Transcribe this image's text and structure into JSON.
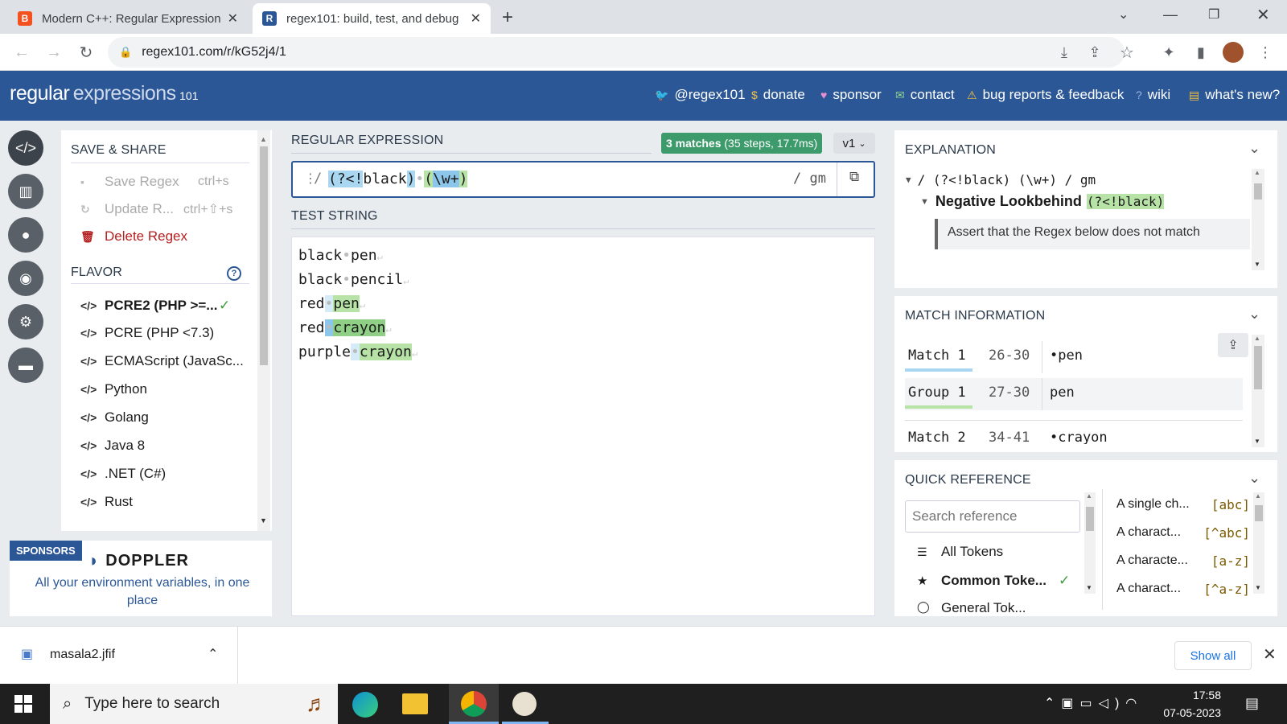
{
  "browser": {
    "tabs": [
      {
        "title": "Modern C++: Regular Expression",
        "favicon": "B",
        "favicon_color": "#f4511e"
      },
      {
        "title": "regex101: build, test, and debug",
        "favicon": "R",
        "favicon_color": "#2b5797"
      }
    ],
    "url": "regex101.com/r/kG52j4/1"
  },
  "site": {
    "logo_main": "regular",
    "logo_sub": "expressions",
    "logo_num": "101",
    "links": [
      "@regex101",
      "donate",
      "sponsor",
      "contact",
      "bug reports & feedback",
      "wiki",
      "what's new?"
    ]
  },
  "sidebar": {
    "save_title": "SAVE & SHARE",
    "save_items": [
      {
        "label": "Save Regex",
        "shortcut": "ctrl+s"
      },
      {
        "label": "Update R...",
        "shortcut": "ctrl+⇧+s"
      },
      {
        "label": "Delete Regex",
        "shortcut": ""
      }
    ],
    "flavor_title": "FLAVOR",
    "flavors": [
      "PCRE2 (PHP >=...",
      "PCRE (PHP <7.3)",
      "ECMAScript (JavaSc...",
      "Python",
      "Golang",
      "Java 8",
      ".NET (C#)",
      "Rust"
    ],
    "sponsors_badge": "SPONSORS",
    "sponsor_name": "DOPPLER",
    "sponsor_text": "All your environment variables, in one place"
  },
  "regex": {
    "title": "REGULAR EXPRESSION",
    "matches_badge_bold": "3 matches",
    "matches_badge_rest": "(35 steps, 17.7ms)",
    "version": "v1",
    "delimiter": "/",
    "tokens": [
      "(?<!",
      "black",
      ")",
      "•",
      "(",
      "\\w+",
      ")"
    ],
    "flags": "/ gm"
  },
  "test": {
    "title": "TEST STRING",
    "lines": [
      "black",
      "pen",
      "black",
      "pencil",
      "red",
      "pen",
      "red",
      "crayon",
      "purple",
      "crayon"
    ]
  },
  "explanation": {
    "title": "EXPLANATION",
    "root": "/ (?<!black) (\\w+) / gm",
    "node_title": "Negative Lookbehind",
    "node_token": "(?<!black)",
    "node_desc": "Assert that the Regex below does not match"
  },
  "match_info": {
    "title": "MATCH INFORMATION",
    "rows": [
      {
        "label": "Match 1",
        "range": "26-30",
        "value": "•pen"
      },
      {
        "label": "Group 1",
        "range": "27-30",
        "value": "pen"
      },
      {
        "label": "Match 2",
        "range": "34-41",
        "value": "•crayon"
      }
    ]
  },
  "quick_ref": {
    "title": "QUICK REFERENCE",
    "search_placeholder": "Search reference",
    "categories": [
      "All Tokens",
      "Common Toke...",
      "General Tok..."
    ],
    "entries": [
      {
        "desc": "A single ch...",
        "token": "[abc]"
      },
      {
        "desc": "A charact...",
        "token": "[^abc]"
      },
      {
        "desc": "A characte...",
        "token": "[a-z]"
      },
      {
        "desc": "A charact...",
        "token": "[^a-z]"
      }
    ]
  },
  "download": {
    "file": "masala2.jfif",
    "show_all": "Show all"
  },
  "taskbar": {
    "search": "Type here to search",
    "time": "17:58",
    "date": "07-05-2023"
  }
}
